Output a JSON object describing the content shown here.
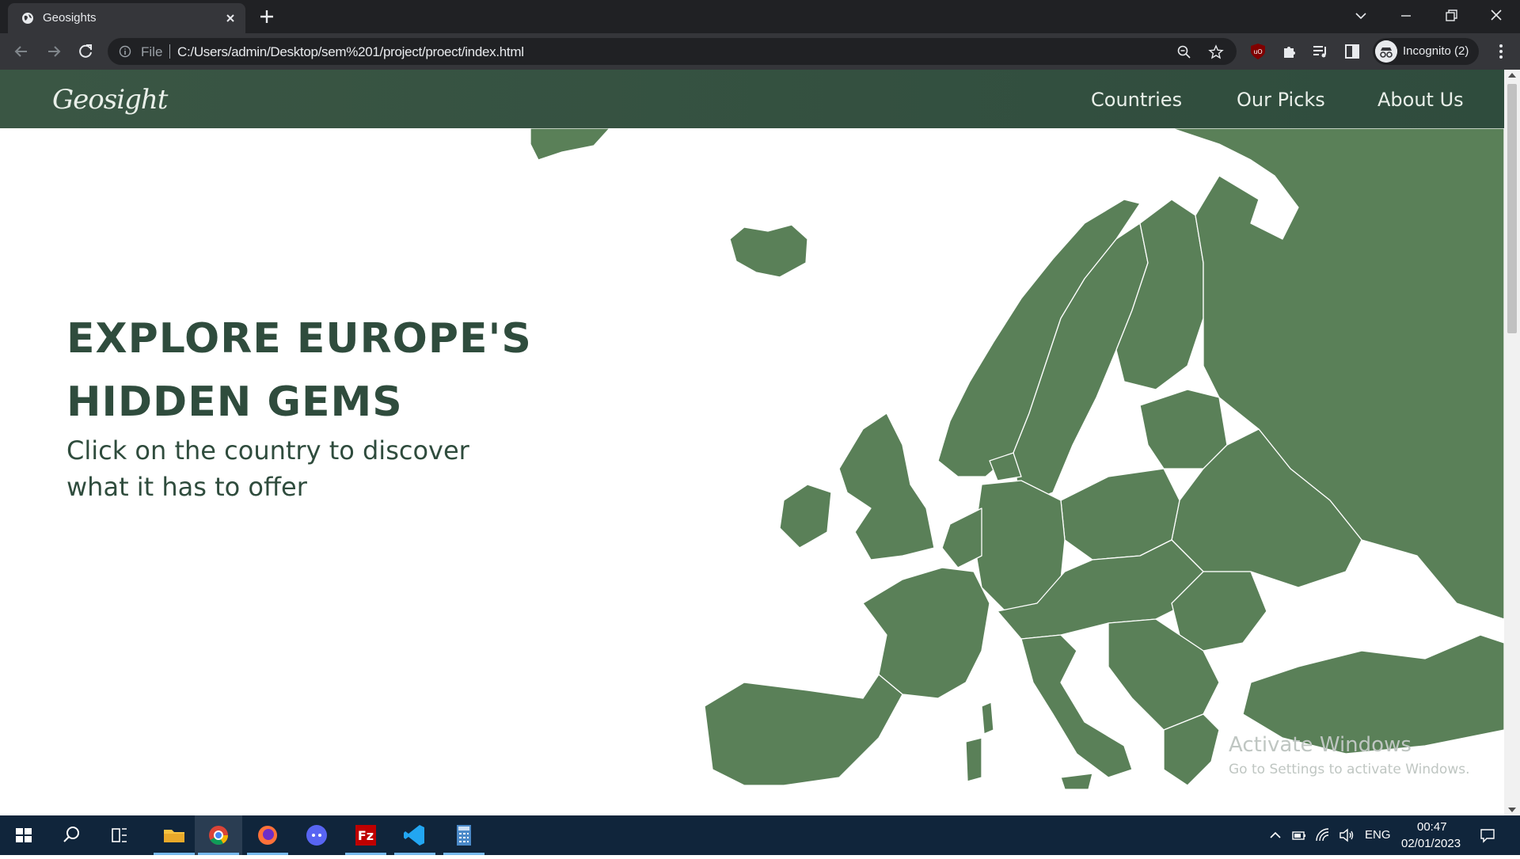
{
  "browser": {
    "tab_title": "Geosights",
    "file_label": "File",
    "url": "C:/Users/admin/Desktop/sem%201/project/proect/index.html",
    "profile_label": "Incognito (2)"
  },
  "site": {
    "logo": "Geosight",
    "nav": [
      "Countries",
      "Our Picks",
      "About Us"
    ],
    "hero_title_line1": "EXPLORE EUROPE'S",
    "hero_title_line2": "HIDDEN GEMS",
    "hero_subtitle": "Click on the country to discover what it has to offer",
    "map_color": "#5a8058",
    "nav_color": "#2f4c3d"
  },
  "os": {
    "watermark_title": "Activate Windows",
    "watermark_text": "Go to Settings to activate Windows.",
    "language": "ENG",
    "time": "00:47",
    "date": "02/01/2023",
    "taskbar_apps": [
      "start-icon",
      "search-icon",
      "task-view-icon",
      "file-explorer-icon",
      "chrome-icon",
      "firefox-icon",
      "discord-icon",
      "filezilla-icon",
      "vscode-icon",
      "calculator-icon"
    ]
  }
}
